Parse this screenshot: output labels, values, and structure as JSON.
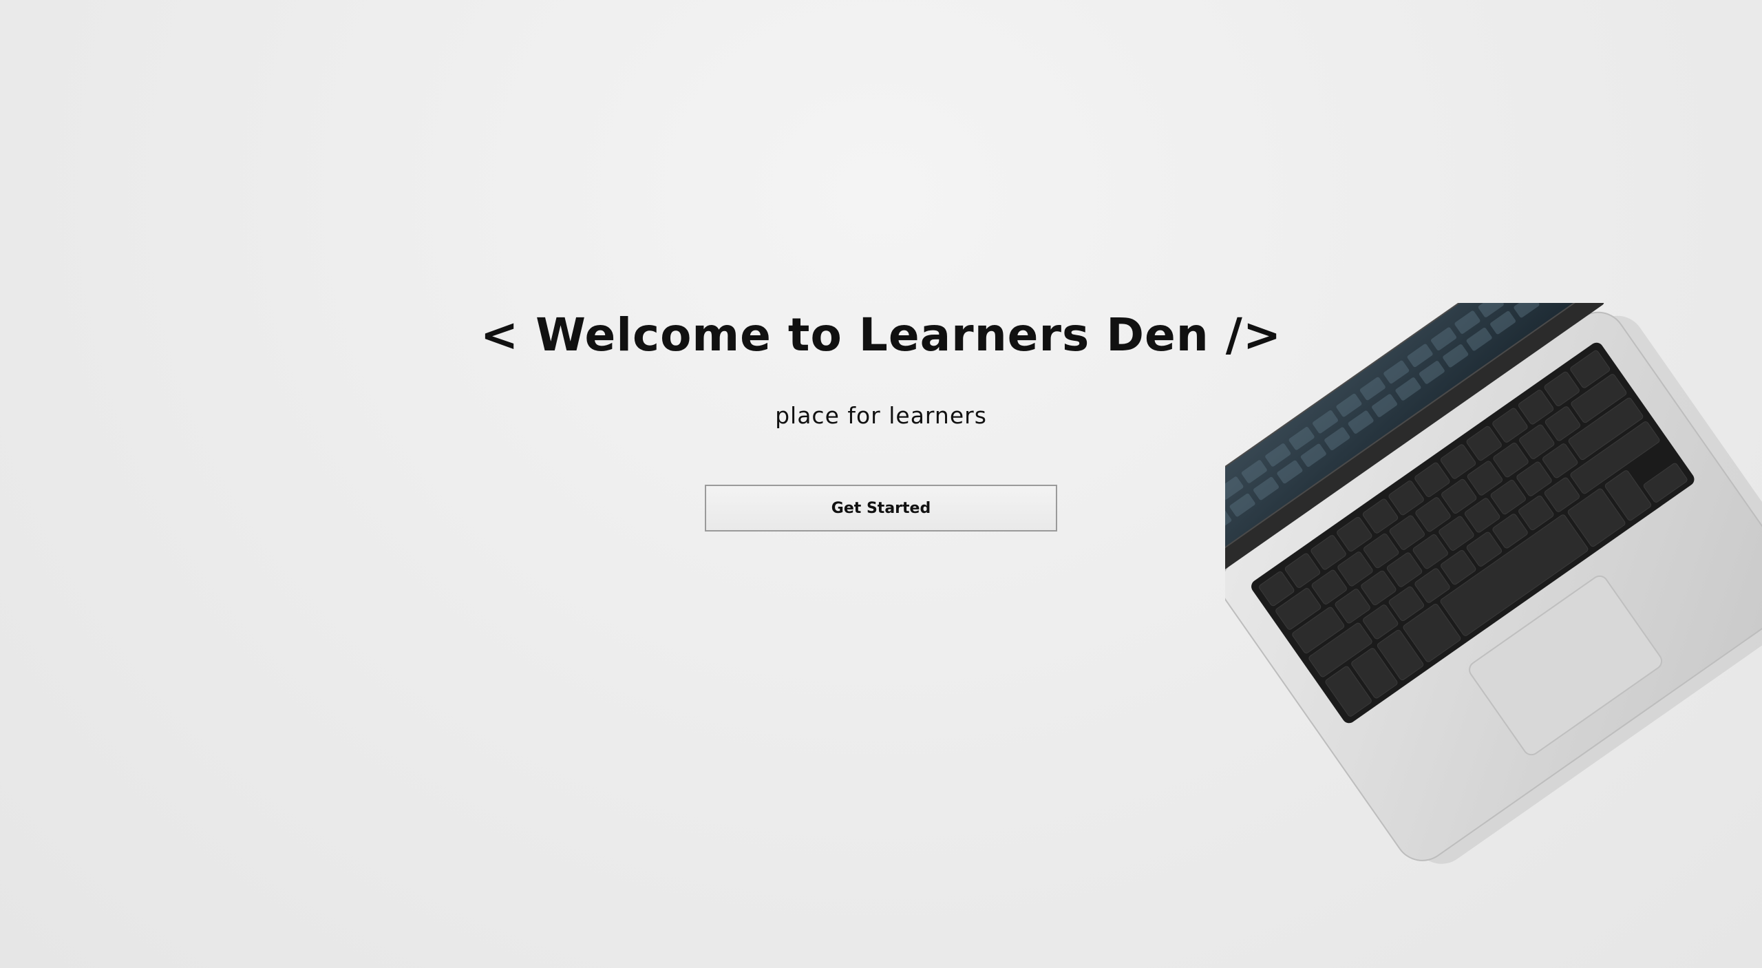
{
  "hero": {
    "title": "< Welcome to Learners Den />",
    "subtitle": "place for learners",
    "cta_label": "Get Started"
  },
  "colors": {
    "background": "#ececec",
    "text": "#111111",
    "button_border": "#9a9a9a"
  },
  "decor": {
    "image": "laptop-keyboard-photo"
  }
}
